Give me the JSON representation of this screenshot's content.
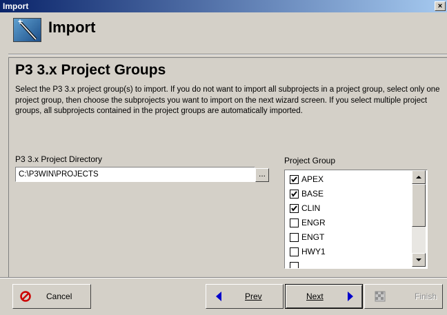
{
  "window": {
    "title": "Import",
    "close_glyph": "×"
  },
  "header": {
    "title": "Import",
    "icon": "wizard-wand-icon"
  },
  "section": {
    "title": "P3 3.x Project Groups",
    "description": "Select the P3 3.x project group(s) to import. If you do not want to import all subprojects in a project group, select only one project group, then choose the subprojects you want to import on the next wizard screen. If you select multiple project groups, all subprojects contained in the project groups are automatically imported."
  },
  "directory": {
    "label": "P3 3.x Project Directory",
    "value": "C:\\P3WIN\\PROJECTS",
    "browse_label": "..."
  },
  "project_group": {
    "label": "Project Group",
    "items": [
      {
        "label": "APEX",
        "checked": true
      },
      {
        "label": "BASE",
        "checked": true
      },
      {
        "label": "CLIN",
        "checked": true
      },
      {
        "label": "ENGR",
        "checked": false
      },
      {
        "label": "ENGT",
        "checked": false
      },
      {
        "label": "HWY1",
        "checked": false
      }
    ]
  },
  "buttons": {
    "cancel": "Cancel",
    "prev": "Prev",
    "next": "Next",
    "finish": "Finish"
  },
  "colors": {
    "accent": "#0a246a",
    "face": "#d4d0c8",
    "arrow": "#0000cc",
    "cancel_icon": "#cc0000"
  }
}
